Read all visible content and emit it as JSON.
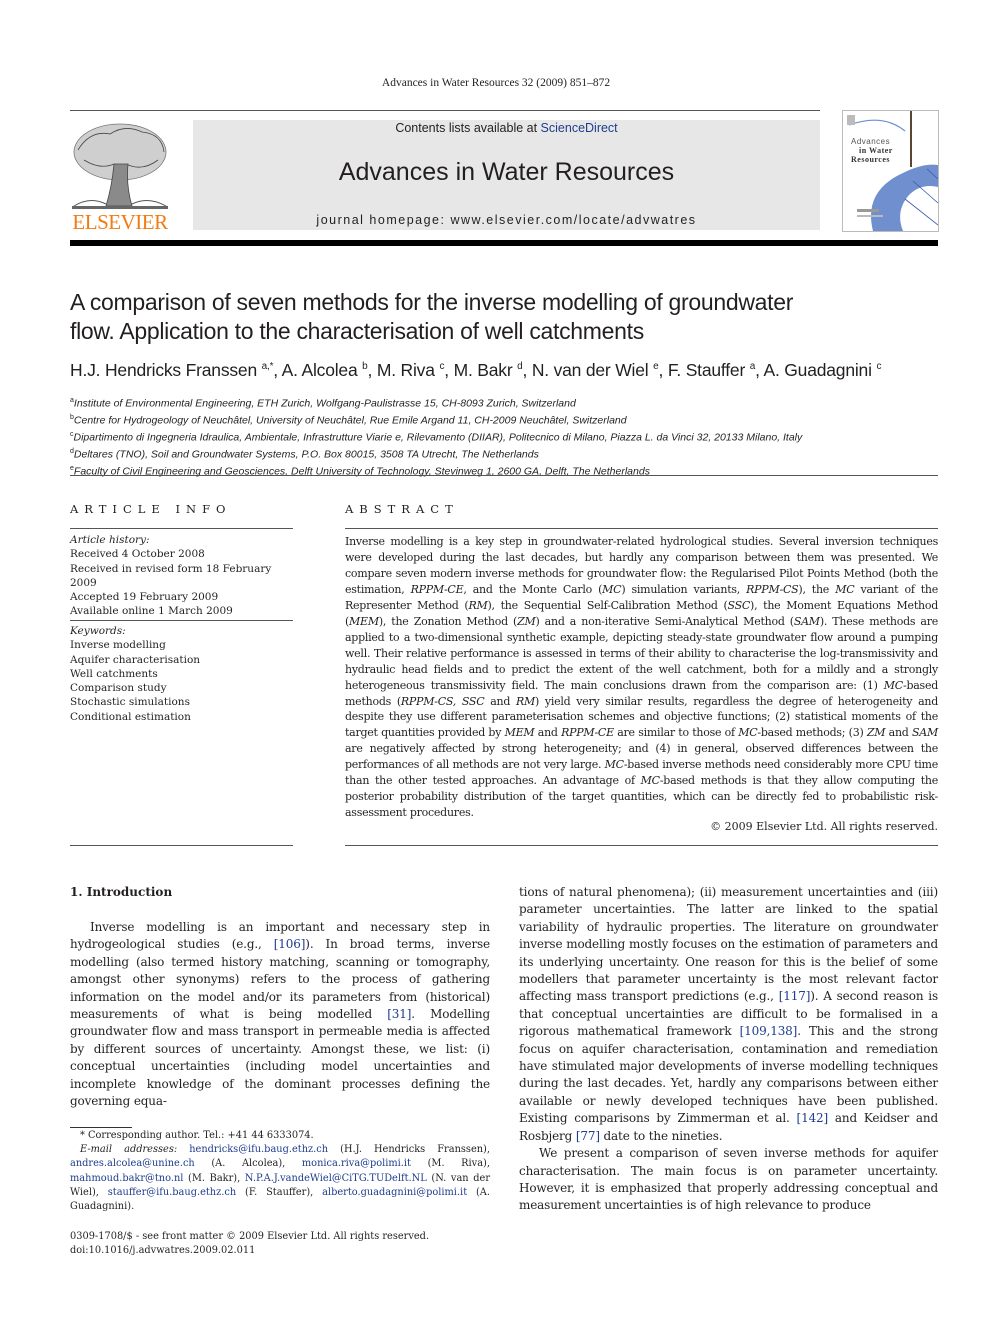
{
  "running_head": "Advances in Water Resources 32 (2009) 851–872",
  "masthead": {
    "contents_prefix": "Contents lists available at ",
    "contents_link": "ScienceDirect",
    "journal_title": "Advances in Water Resources",
    "homepage": "journal homepage: www.elsevier.com/locate/advwatres",
    "publisher_logo_text": "ELSEVIER",
    "cover_lines": [
      "Advances",
      "in Water",
      "Resources"
    ]
  },
  "colors": {
    "elsevier_orange": "#f07c14",
    "link_blue": "#1e3c8c",
    "masthead_grey": "#e7e7e7",
    "cover_blue": "#6f8fcf"
  },
  "article": {
    "title_line1": "A comparison of seven methods for the inverse modelling of groundwater",
    "title_line2": "flow. Application to the characterisation of well catchments",
    "authors": [
      {
        "name": "H.J. Hendricks Franssen",
        "sup": "a,*"
      },
      {
        "name": "A. Alcolea",
        "sup": "b"
      },
      {
        "name": "M. Riva",
        "sup": "c"
      },
      {
        "name": "M. Bakr",
        "sup": "d"
      },
      {
        "name": "N. van der Wiel",
        "sup": "e"
      },
      {
        "name": "F. Stauffer",
        "sup": "a"
      },
      {
        "name": "A. Guadagnini",
        "sup": "c"
      }
    ],
    "affiliations": [
      {
        "key": "a",
        "text": "Institute of Environmental Engineering, ETH Zurich, Wolfgang-Paulistrasse 15, CH-8093 Zurich, Switzerland"
      },
      {
        "key": "b",
        "text": "Centre for Hydrogeology of Neuchâtel, University of Neuchâtel, Rue Emile Argand 11, CH-2009 Neuchâtel, Switzerland"
      },
      {
        "key": "c",
        "text": "Dipartimento di Ingegneria Idraulica, Ambientale, Infrastrutture Viarie e, Rilevamento (DIIAR), Politecnico di Milano, Piazza L. da Vinci 32, 20133 Milano, Italy"
      },
      {
        "key": "d",
        "text": "Deltares (TNO), Soil and Groundwater Systems, P.O. Box 80015, 3508 TA Utrecht, The Netherlands"
      },
      {
        "key": "e",
        "text": "Faculty of Civil Engineering and Geosciences, Delft University of Technology, Stevinweg 1, 2600 GA, Delft, The Netherlands"
      }
    ]
  },
  "article_info": {
    "heading": "ARTICLE INFO",
    "history_label": "Article history:",
    "history": [
      "Received 4 October 2008",
      "Received in revised form 18 February 2009",
      "Accepted 19 February 2009",
      "Available online 1 March 2009"
    ],
    "keywords_label": "Keywords:",
    "keywords": [
      "Inverse modelling",
      "Aquifer characterisation",
      "Well catchments",
      "Comparison study",
      "Stochastic simulations",
      "Conditional estimation"
    ]
  },
  "abstract": {
    "heading": "ABSTRACT",
    "segments": [
      {
        "t": "Inverse modelling is a key step in groundwater-related hydrological studies. Several inversion techniques were developed during the last decades, but hardly any comparison between them was presented. We compare seven modern inverse methods for groundwater flow: the Regularised Pilot Points Method (both the estimation, "
      },
      {
        "t": "RPPM-CE",
        "i": true
      },
      {
        "t": ", and the Monte Carlo ("
      },
      {
        "t": "MC",
        "i": true
      },
      {
        "t": ") simulation variants, "
      },
      {
        "t": "RPPM-CS",
        "i": true
      },
      {
        "t": "), the "
      },
      {
        "t": "MC",
        "i": true
      },
      {
        "t": " variant of the Representer Method ("
      },
      {
        "t": "RM",
        "i": true
      },
      {
        "t": "), the Sequential Self-Calibration Method ("
      },
      {
        "t": "SSC",
        "i": true
      },
      {
        "t": "), the Moment Equations Method ("
      },
      {
        "t": "MEM",
        "i": true
      },
      {
        "t": "), the Zonation Method ("
      },
      {
        "t": "ZM",
        "i": true
      },
      {
        "t": ") and a non-iterative Semi-Analytical Method ("
      },
      {
        "t": "SAM",
        "i": true
      },
      {
        "t": "). These methods are applied to a two-dimensional synthetic example, depicting steady-state groundwater flow around a pumping well. Their relative performance is assessed in terms of their ability to characterise the log-transmissivity and hydraulic head fields and to predict the extent of the well catchment, both for a mildly and a strongly heterogeneous transmissivity field. The main conclusions drawn from the comparison are: (1) "
      },
      {
        "t": "MC",
        "i": true
      },
      {
        "t": "-based methods ("
      },
      {
        "t": "RPPM-CS, SSC",
        "i": true
      },
      {
        "t": " and "
      },
      {
        "t": "RM",
        "i": true
      },
      {
        "t": ") yield very similar results, regardless the degree of heterogeneity and despite they use different parameterisation schemes and objective functions; (2) statistical moments of the target quantities provided by "
      },
      {
        "t": "MEM",
        "i": true
      },
      {
        "t": " and "
      },
      {
        "t": "RPPM-CE",
        "i": true
      },
      {
        "t": " are similar to those of "
      },
      {
        "t": "MC",
        "i": true
      },
      {
        "t": "-based methods; (3) "
      },
      {
        "t": "ZM",
        "i": true
      },
      {
        "t": " and "
      },
      {
        "t": "SAM",
        "i": true
      },
      {
        "t": " are negatively affected by strong heterogeneity; and (4) in general, observed differences between the performances of all methods are not very large. "
      },
      {
        "t": "MC",
        "i": true
      },
      {
        "t": "-based inverse methods need considerably more CPU time than the other tested approaches. An advantage of "
      },
      {
        "t": "MC",
        "i": true
      },
      {
        "t": "-based methods is that they allow computing the posterior probability distribution of the target quantities, which can be directly fed to probabilistic risk-assessment procedures."
      }
    ],
    "copyright": "© 2009 Elsevier Ltd. All rights reserved."
  },
  "introduction": {
    "heading": "1. Introduction",
    "left_segments": [
      {
        "t": "Inverse modelling is an important and necessary step in hydrogeological studies (e.g., "
      },
      {
        "t": "[106]",
        "ref": true
      },
      {
        "t": "). In broad terms, inverse modelling (also termed history matching, scanning or tomography, amongst other synonyms) refers to the process of gathering information on the model and/or its parameters from (historical) measurements of what is being modelled "
      },
      {
        "t": "[31]",
        "ref": true
      },
      {
        "t": ". Modelling groundwater flow and mass transport in permeable media is affected by different sources of uncertainty. Amongst these, we list: (i) conceptual uncertainties (including model uncertainties and incomplete knowledge of the dominant processes defining the governing equa-"
      }
    ],
    "right_p1_segments": [
      {
        "t": "tions of natural phenomena); (ii) measurement uncertainties and (iii) parameter uncertainties. The latter are linked to the spatial variability of hydraulic properties. The literature on groundwater inverse modelling mostly focuses on the estimation of parameters and its underlying uncertainty. One reason for this is the belief of some modellers that parameter uncertainty is the most relevant factor affecting mass transport predictions (e.g., "
      },
      {
        "t": "[117]",
        "ref": true
      },
      {
        "t": "). A second reason is that conceptual uncertainties are difficult to be formalised in a rigorous mathematical framework "
      },
      {
        "t": "[109,138]",
        "ref": true
      },
      {
        "t": ". This and the strong focus on aquifer characterisation, contamination and remediation have stimulated major developments of inverse modelling techniques during the last decades. Yet, hardly any comparisons between either available or newly developed techniques have been published. Existing comparisons by Zimmerman et al. "
      },
      {
        "t": "[142]",
        "ref": true
      },
      {
        "t": " and Keidser and Rosbjerg "
      },
      {
        "t": "[77]",
        "ref": true
      },
      {
        "t": " date to the nineties."
      }
    ],
    "right_p2_segments": [
      {
        "t": "We present a comparison of seven inverse methods for aquifer characterisation. The main focus is on parameter uncertainty. However, it is emphasized that properly addressing conceptual and measurement uncertainties is of high relevance to produce"
      }
    ]
  },
  "footnotes": {
    "corresponding": "* Corresponding author. Tel.: +41 44 6333074.",
    "email_segments": [
      {
        "t": "E-mail addresses: ",
        "i": true
      },
      {
        "t": "hendricks@ifu.baug.ethz.ch",
        "email": true
      },
      {
        "t": " (H.J. Hendricks Franssen), "
      },
      {
        "t": "andres.alcolea@unine.ch",
        "email": true
      },
      {
        "t": " (A. Alcolea), "
      },
      {
        "t": "monica.riva@polimi.it",
        "email": true
      },
      {
        "t": " (M. Riva), "
      },
      {
        "t": "mahmoud.bakr@tno.nl",
        "email": true
      },
      {
        "t": " (M. Bakr), "
      },
      {
        "t": "N.P.A.J.vandeWiel@CiTG.TUDelft.NL",
        "email": true
      },
      {
        "t": " (N. van der Wiel), "
      },
      {
        "t": "stauffer@ifu.baug.ethz.ch",
        "email": true
      },
      {
        "t": " (F. Stauffer), "
      },
      {
        "t": "alberto.guadagnini@polimi.it",
        "email": true
      },
      {
        "t": " (A. Guadagnini)."
      }
    ],
    "front_matter": "0309-1708/$ - see front matter © 2009 Elsevier Ltd. All rights reserved.",
    "doi": "doi:10.1016/j.advwatres.2009.02.011"
  }
}
